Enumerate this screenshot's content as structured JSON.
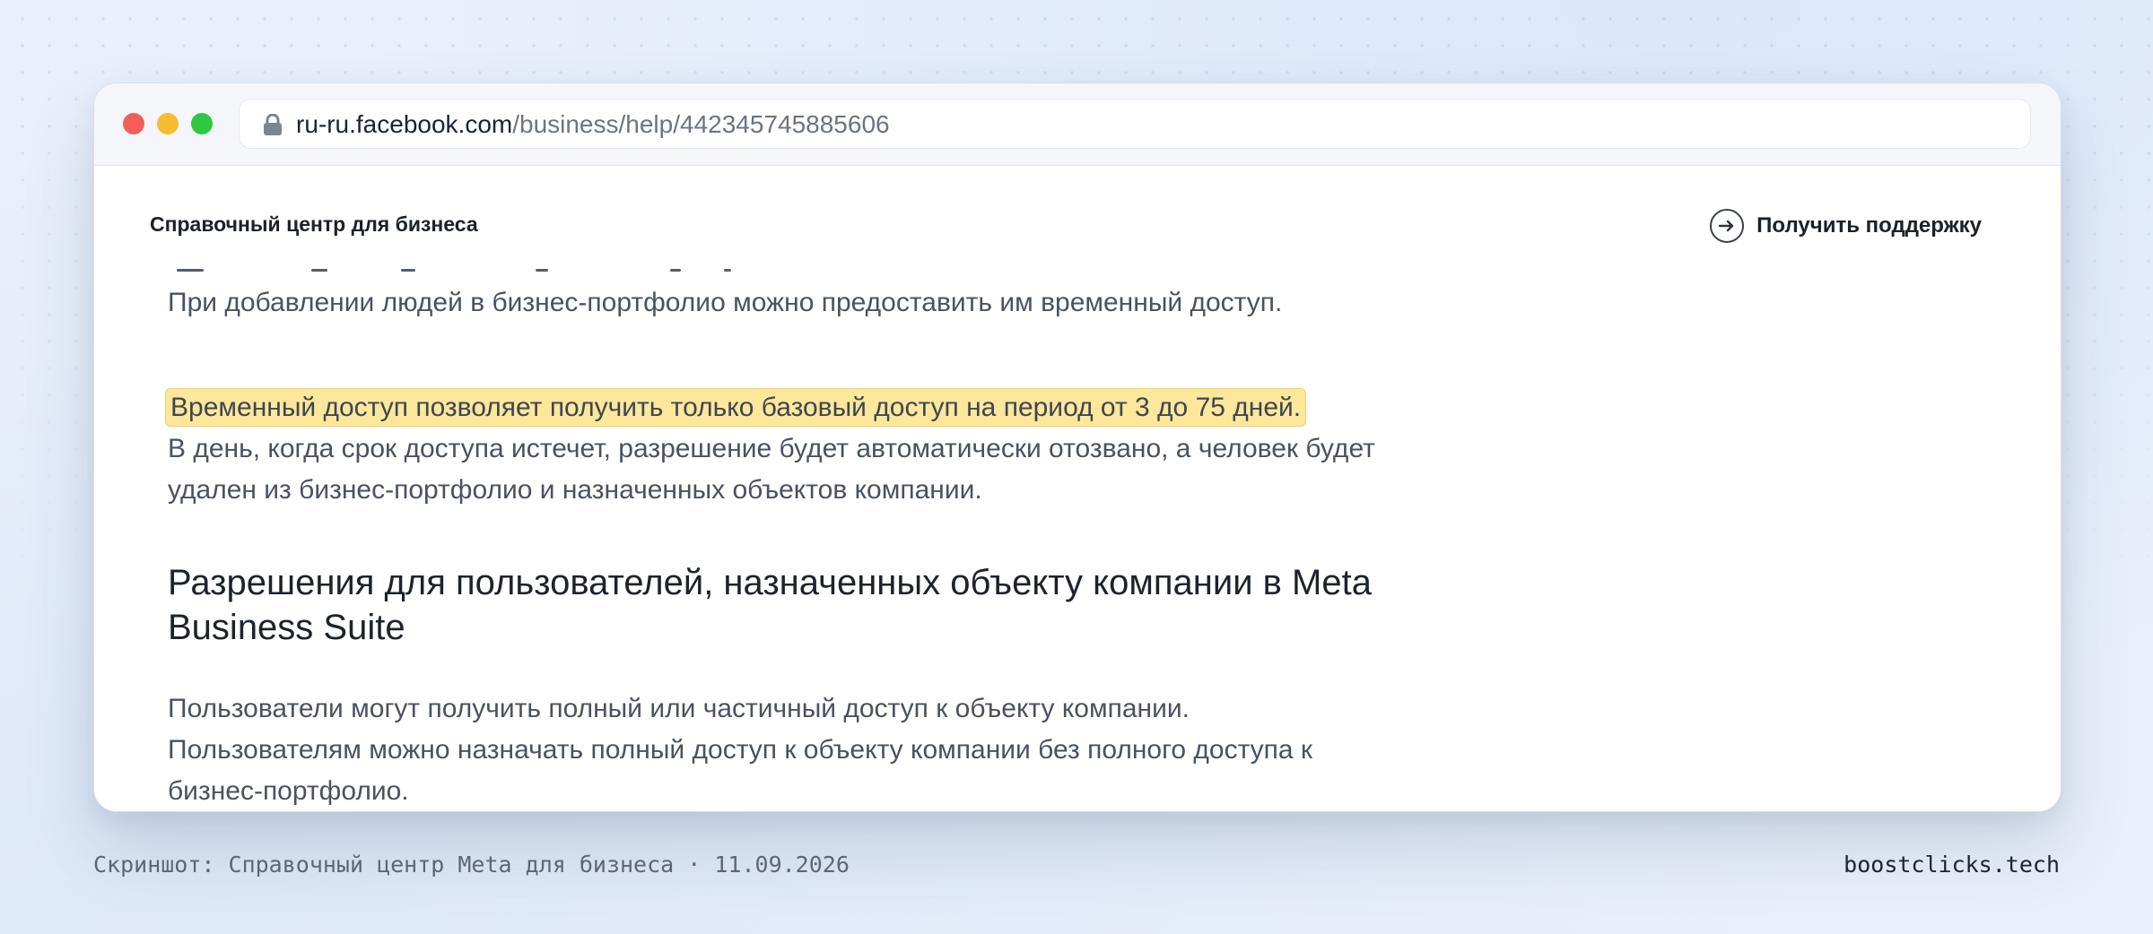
{
  "browser": {
    "url_host": "ru-ru.facebook.com",
    "url_path": "/business/help/442345745885606"
  },
  "page": {
    "site_title": "Справочный центр для бизнеса",
    "support_label": "Получить поддержку",
    "paragraph_1": "При добавлении людей в бизнес-портфолио можно предоставить им временный доступ.",
    "highlight_text": "Временный доступ позволяет получить только базовый доступ на период от 3 до 75 дней.",
    "paragraph_2": "В день, когда срок доступа истечет, разрешение будет автоматически отозвано, а человек будет удален из бизнес-портфолио и назначенных объектов компании.",
    "heading": "Разрешения для пользователей, назначенных объекту компании в Meta Business Suite",
    "paragraph_3": "Пользователи могут получить полный или частичный доступ к объекту компании. Пользователям можно назначать полный доступ к объекту компании без полного доступа к бизнес-портфолио."
  },
  "footer": {
    "caption": "Скриншот: Справочный центр Meta для бизнеса · 11.09.2026",
    "brand": "boostclicks.tech"
  },
  "colors": {
    "highlight": "#fde79a",
    "traffic_red": "#f25f58",
    "traffic_yellow": "#f8bc2f",
    "traffic_green": "#2ec841"
  },
  "icons": [
    "lock-icon",
    "arrow-right-circle-icon"
  ]
}
